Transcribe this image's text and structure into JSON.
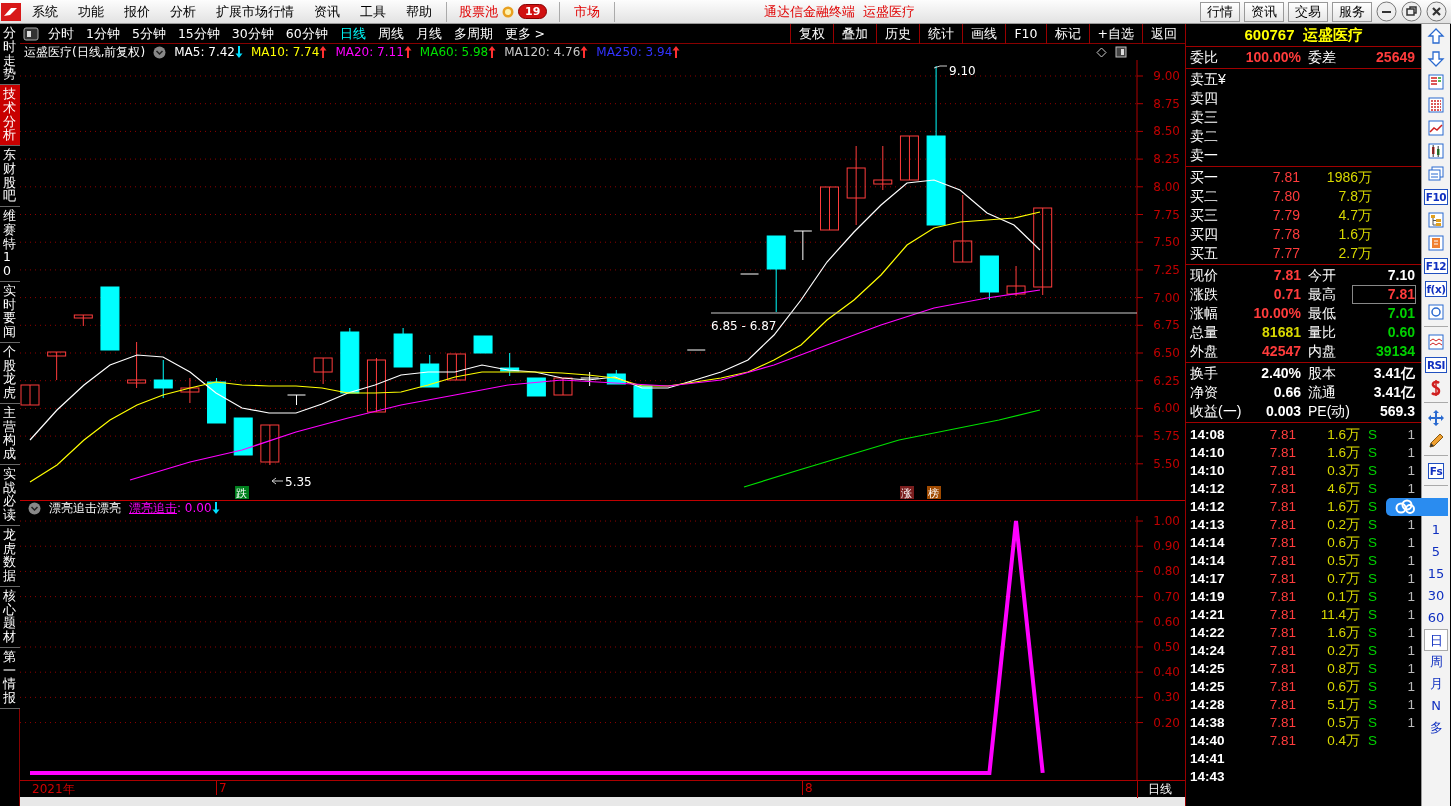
{
  "menu_bar": {
    "items": [
      "系统",
      "功能",
      "报价",
      "分析",
      "扩展市场行情",
      "资讯",
      "工具",
      "帮助"
    ],
    "stock_pool": {
      "label": "股票池",
      "badge": "19"
    },
    "market": "市场",
    "title": "通达信金融终端  运盛医疗",
    "buttons": [
      "行情",
      "资讯",
      "交易",
      "服务"
    ]
  },
  "side_tabs": [
    {
      "label": "分时走势",
      "selected": false
    },
    {
      "label": "技术分析",
      "selected": true
    },
    {
      "label": "东财股吧",
      "selected": false
    },
    {
      "label": "维赛特10",
      "selected": false
    },
    {
      "label": "实时要闻",
      "selected": false
    },
    {
      "label": "个股龙虎",
      "selected": false
    },
    {
      "label": "主营构成",
      "selected": false
    },
    {
      "label": "实战必读",
      "selected": false
    },
    {
      "label": "龙虎数据",
      "selected": false
    },
    {
      "label": "核心题材",
      "selected": false
    },
    {
      "label": "第一情报",
      "selected": false
    }
  ],
  "chart_toolbar": {
    "periods": [
      {
        "label": "分时",
        "selected": false
      },
      {
        "label": "1分钟",
        "selected": false
      },
      {
        "label": "5分钟",
        "selected": false
      },
      {
        "label": "15分钟",
        "selected": false
      },
      {
        "label": "30分钟",
        "selected": false
      },
      {
        "label": "60分钟",
        "selected": false
      },
      {
        "label": "日线",
        "selected": true
      },
      {
        "label": "周线",
        "selected": false
      },
      {
        "label": "月线",
        "selected": false
      },
      {
        "label": "多周期",
        "selected": false
      },
      {
        "label": "更多 >",
        "selected": false
      }
    ],
    "actions": [
      "复权",
      "叠加",
      "历史",
      "统计",
      "画线",
      "F10",
      "标记",
      "+自选",
      "返回"
    ]
  },
  "legend": {
    "title": "运盛医疗(日线,前复权)",
    "indicators": [
      {
        "label": "MA5: 7.42",
        "arrow": {
          "kind": "down",
          "color": "#00e0ff"
        },
        "color": "#ffffff"
      },
      {
        "label": "MA10: 7.74",
        "arrow": {
          "kind": "up",
          "color": "#ff3030"
        },
        "color": "#ffff00"
      },
      {
        "label": "MA20: 7.11",
        "arrow": {
          "kind": "up",
          "color": "#ff3030"
        },
        "color": "#ff00ff"
      },
      {
        "label": "MA60: 5.98",
        "arrow": {
          "kind": "up",
          "color": "#ff3030"
        },
        "color": "#00e000"
      },
      {
        "label": "MA120: 4.76",
        "arrow": {
          "kind": "up",
          "color": "#ff3030"
        },
        "color": "#c8c8c8"
      },
      {
        "label": "MA250: 3.94",
        "arrow": {
          "kind": "up",
          "color": "#ff3030"
        },
        "color": "#3333ff"
      }
    ]
  },
  "price_chart": {
    "y_labels": [
      "9.00",
      "8.75",
      "8.50",
      "8.25",
      "8.00",
      "7.75",
      "7.50",
      "7.25",
      "7.00",
      "6.75",
      "6.50",
      "6.25",
      "6.00",
      "5.75",
      "5.50"
    ],
    "annotations": [
      {
        "kind": "high",
        "label": "9.10"
      },
      {
        "kind": "range",
        "label": "6.85 - 6.87"
      },
      {
        "kind": "low",
        "label": "5.35"
      }
    ],
    "markers": [
      {
        "label": "跌",
        "color": "#00801e"
      },
      {
        "label": "涨",
        "color": "#7a1e1e"
      },
      {
        "label": "榜",
        "color": "#a04a00"
      }
    ]
  },
  "indicator_panel": {
    "title": "漂亮追击漂亮",
    "reading": ": 0.00",
    "arrow": {
      "kind": "down",
      "color": "#00e0ff"
    },
    "chart_data": {
      "type": "line",
      "grid": true,
      "ylim": [
        -0.028,
        1.02
      ],
      "yticks": [
        {
          "value": 1,
          "label": "1.00"
        },
        {
          "value": 0.9,
          "label": "0.90"
        },
        {
          "value": 0.8,
          "label": "0.80"
        },
        {
          "value": 0.7,
          "label": "0.70"
        },
        {
          "value": 0.6,
          "label": "0.60"
        },
        {
          "value": 0.5,
          "label": "0.50"
        },
        {
          "value": 0.4,
          "label": "0.40"
        },
        {
          "value": 0.3,
          "label": "0.30"
        },
        {
          "value": 0.2,
          "label": "0.20"
        }
      ],
      "series": [
        {
          "name": "漂亮追击",
          "color": "#ff00ff",
          "values": [
            0,
            0,
            0,
            0,
            0,
            0,
            0,
            0,
            0,
            0,
            0,
            0,
            0,
            0,
            0,
            0,
            0,
            0,
            0,
            0,
            0,
            0,
            0,
            0,
            0,
            0,
            0,
            0,
            0,
            0,
            0,
            0,
            0,
            0,
            0,
            0,
            0,
            1,
            0
          ]
        }
      ]
    }
  },
  "date_axis": {
    "labels": [
      "2021年",
      "7",
      "8"
    ],
    "period": "日线"
  },
  "quote_panel": {
    "code": "600767",
    "name": "运盛医疗",
    "order_row": [
      {
        "label": "委比",
        "value": "100.00%"
      },
      {
        "label": "委差",
        "value": "25649"
      }
    ],
    "asks": [
      {
        "label": "卖五¥"
      },
      {
        "label": "卖四"
      },
      {
        "label": "卖三"
      },
      {
        "label": "卖二"
      },
      {
        "label": "卖一"
      }
    ],
    "bids": [
      {
        "label": "买一",
        "price": "7.81",
        "volume": "1986万"
      },
      {
        "label": "买二",
        "price": "7.80",
        "volume": "7.8万"
      },
      {
        "label": "买三",
        "price": "7.79",
        "volume": "4.7万"
      },
      {
        "label": "买四",
        "price": "7.78",
        "volume": "1.6万"
      },
      {
        "label": "买五",
        "price": "7.77",
        "volume": "2.7万"
      }
    ],
    "stats": [
      [
        {
          "label": "现价",
          "value": "7.81",
          "color": "#ff3c3c",
          "highlighted": false
        },
        {
          "label": "今开",
          "value": "7.10",
          "color": "#ffffff",
          "highlighted": false
        }
      ],
      [
        {
          "label": "涨跌",
          "value": "0.71",
          "color": "#ff3c3c",
          "highlighted": false
        },
        {
          "label": "最高",
          "value": "7.81",
          "color": "#ff3c3c",
          "highlighted": true
        }
      ],
      [
        {
          "label": "涨幅",
          "value": "10.00%",
          "color": "#ff3c3c",
          "highlighted": false
        },
        {
          "label": "最低",
          "value": "7.01",
          "color": "#00d000",
          "highlighted": false
        }
      ],
      [
        {
          "label": "总量",
          "value": "81681",
          "color": "#d8d800",
          "highlighted": false
        },
        {
          "label": "量比",
          "value": "0.60",
          "color": "#00d000",
          "highlighted": false
        }
      ],
      [
        {
          "label": "外盘",
          "value": "42547",
          "color": "#ff3c3c",
          "highlighted": false
        },
        {
          "label": "内盘",
          "value": "39134",
          "color": "#00d000",
          "highlighted": false
        }
      ]
    ],
    "finance": [
      [
        {
          "label": "换手",
          "value": "2.40%",
          "color": "#ffffff",
          "highlighted": false
        },
        {
          "label": "股本",
          "value": "3.41亿",
          "color": "#ffffff",
          "highlighted": false
        }
      ],
      [
        {
          "label": "净资",
          "value": "0.66",
          "color": "#ffffff",
          "highlighted": false
        },
        {
          "label": "流通",
          "value": "3.41亿",
          "color": "#ffffff",
          "highlighted": false
        }
      ],
      [
        {
          "label": "收益(一)",
          "value": "0.003",
          "color": "#ffffff",
          "highlighted": false
        },
        {
          "label": "PE(动)",
          "value": "569.3",
          "color": "#ffffff",
          "highlighted": false
        }
      ]
    ],
    "ticks": [
      {
        "time": "14:08",
        "price": "7.81",
        "volume": "1.6万",
        "side": "S",
        "count": "1"
      },
      {
        "time": "14:10",
        "price": "7.81",
        "volume": "1.6万",
        "side": "S",
        "count": "1"
      },
      {
        "time": "14:10",
        "price": "7.81",
        "volume": "0.3万",
        "side": "S",
        "count": "1"
      },
      {
        "time": "14:12",
        "price": "7.81",
        "volume": "4.6万",
        "side": "S",
        "count": "1"
      },
      {
        "time": "14:12",
        "price": "7.81",
        "volume": "1.6万",
        "side": "S"
      },
      {
        "time": "14:13",
        "price": "7.81",
        "volume": "0.2万",
        "side": "S",
        "count": "1"
      },
      {
        "time": "14:14",
        "price": "7.81",
        "volume": "0.6万",
        "side": "S",
        "count": "1"
      },
      {
        "time": "14:14",
        "price": "7.81",
        "volume": "0.5万",
        "side": "S",
        "count": "1"
      },
      {
        "time": "14:17",
        "price": "7.81",
        "volume": "0.7万",
        "side": "S",
        "count": "1"
      },
      {
        "time": "14:19",
        "price": "7.81",
        "volume": "0.1万",
        "side": "S",
        "count": "1"
      },
      {
        "time": "14:21",
        "price": "7.81",
        "volume": "11.4万",
        "side": "S",
        "count": "1"
      },
      {
        "time": "14:22",
        "price": "7.81",
        "volume": "1.6万",
        "side": "S",
        "count": "1"
      },
      {
        "time": "14:24",
        "price": "7.81",
        "volume": "0.2万",
        "side": "S",
        "count": "1"
      },
      {
        "time": "14:25",
        "price": "7.81",
        "volume": "0.8万",
        "side": "S",
        "count": "1"
      },
      {
        "time": "14:25",
        "price": "7.81",
        "volume": "0.6万",
        "side": "S",
        "count": "1"
      },
      {
        "time": "14:28",
        "price": "7.81",
        "volume": "5.1万",
        "side": "S",
        "count": "1"
      },
      {
        "time": "14:38",
        "price": "7.81",
        "volume": "0.5万",
        "side": "S",
        "count": "1"
      },
      {
        "time": "14:40",
        "price": "7.81",
        "volume": "0.4万",
        "side": "S"
      },
      {
        "time": "14:41"
      },
      {
        "time": "14:43"
      }
    ]
  },
  "right_toolbar": [
    {
      "kind": "icon"
    },
    {
      "kind": "icon"
    },
    {
      "kind": "icon"
    },
    {
      "kind": "icon"
    },
    {
      "kind": "icon"
    },
    {
      "kind": "icon"
    },
    {
      "kind": "icon"
    },
    {
      "kind": "label",
      "label": "F10"
    },
    {
      "kind": "icon"
    },
    {
      "kind": "icon"
    },
    {
      "kind": "label",
      "label": "F12"
    },
    {
      "kind": "label",
      "label": "f(x)"
    },
    {
      "kind": "icon"
    },
    {
      "kind": "separator"
    },
    {
      "kind": "icon"
    },
    {
      "kind": "label",
      "label": "RSI"
    },
    {
      "kind": "icon"
    },
    {
      "kind": "separator"
    },
    {
      "kind": "icon"
    },
    {
      "kind": "icon"
    },
    {
      "kind": "separator"
    },
    {
      "kind": "label",
      "label": "Fs"
    },
    {
      "kind": "separator"
    },
    {
      "kind": "period",
      "label": "1",
      "selected": false
    },
    {
      "kind": "period",
      "label": "5",
      "selected": false
    },
    {
      "kind": "period",
      "label": "15",
      "selected": false
    },
    {
      "kind": "period",
      "label": "30",
      "selected": false
    },
    {
      "kind": "period",
      "label": "60",
      "selected": false
    },
    {
      "kind": "period",
      "label": "日",
      "selected": true
    },
    {
      "kind": "period",
      "label": "周",
      "selected": false
    },
    {
      "kind": "period",
      "label": "月",
      "selected": false
    },
    {
      "kind": "period",
      "label": "N",
      "selected": false
    },
    {
      "kind": "period",
      "label": "多",
      "selected": false
    }
  ]
}
